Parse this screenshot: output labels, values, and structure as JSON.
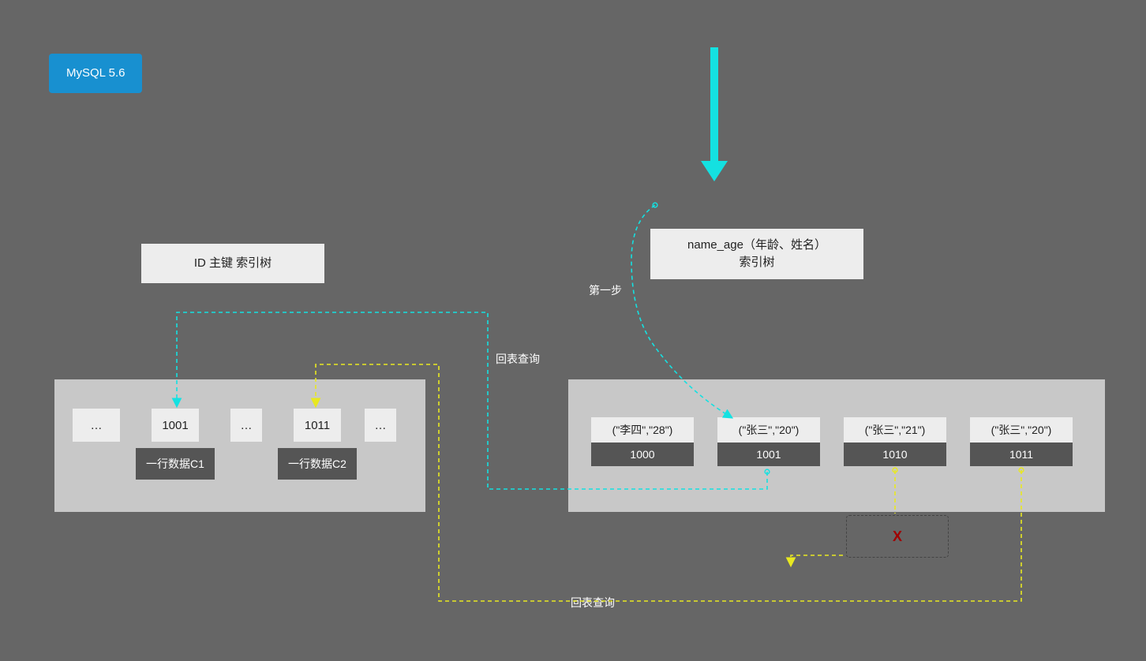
{
  "badge": "MySQL 5.6",
  "leftTitle": "ID 主键 索引树",
  "rightTitle": "name_age（年龄、姓名）\n索引树",
  "stepLabel": "第一步",
  "lookupLabel1": "回表查询",
  "lookupLabel2": "回表查询",
  "rejectLabel": "X",
  "leftCells": {
    "dots1": "…",
    "id1": "1001",
    "dots2": "…",
    "id2": "1011",
    "dots3": "…",
    "row1": "一行数据C1",
    "row2": "一行数据C2"
  },
  "rightEntries": [
    {
      "key": "(\"李四\",\"28\")",
      "val": "1000"
    },
    {
      "key": "(\"张三\",\"20\")",
      "val": "1001"
    },
    {
      "key": "(\"张三\",\"21\")",
      "val": "1010"
    },
    {
      "key": "(\"张三\",\"20\")",
      "val": "1011"
    }
  ]
}
